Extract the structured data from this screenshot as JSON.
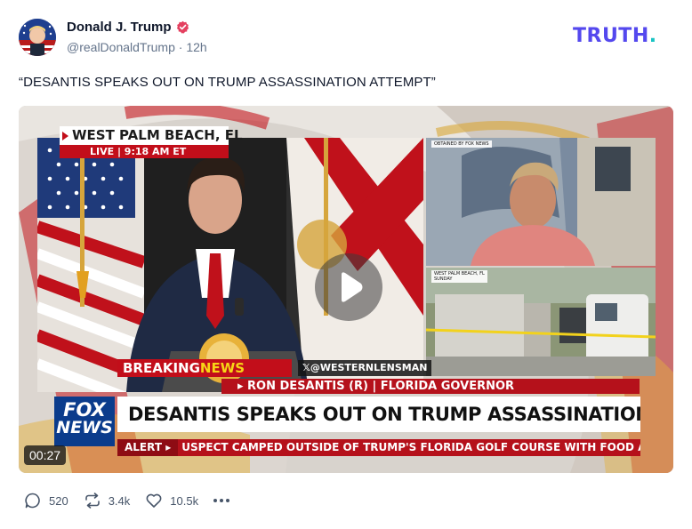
{
  "author": {
    "display_name": "Donald J. Trump",
    "handle": "@realDonaldTrump",
    "separator": "·",
    "time_ago": "12h",
    "verified_color": "#e4405f"
  },
  "brand": {
    "name": "TRUTH",
    "dot": ".",
    "color": "#5448ee",
    "dot_color": "#17c3c3"
  },
  "post": {
    "text": "“DESANTIS SPEAKS OUT ON TRUMP ASSASSINATION ATTEMPT”"
  },
  "video": {
    "duration": "00:27",
    "overlay": {
      "location": "WEST PALM BEACH, FL",
      "live_label": "LIVE | 9:18 AM ET",
      "source_caption": "OBTAINED BY FOX NEWS",
      "secondary_location": "WEST PALM BEACH, FL",
      "secondary_day": "SUNDAY",
      "breaking_label_1": "BREAKING",
      "breaking_label_2": "NEWS",
      "watermark": "𝕏@WESTERNLENSMAN",
      "name_bar": "▸ RON DESANTIS (R) | FLORIDA GOVERNOR",
      "network_line1": "FOX",
      "network_line2": "NEWS",
      "headline": "DESANTIS SPEAKS OUT ON TRUMP ASSASSINATION ATTEMPT",
      "alert_label": "ALERT ▸",
      "ticker": "USPECT CAMPED OUTSIDE OF TRUMP'S FLORIDA GOLF COURSE WITH FOOD AND"
    }
  },
  "actions": {
    "replies": "520",
    "retruths": "3.4k",
    "likes": "10.5k"
  },
  "icons": [
    "reply-icon",
    "retruth-icon",
    "heart-icon",
    "more-icon",
    "play-icon",
    "verified-icon"
  ]
}
